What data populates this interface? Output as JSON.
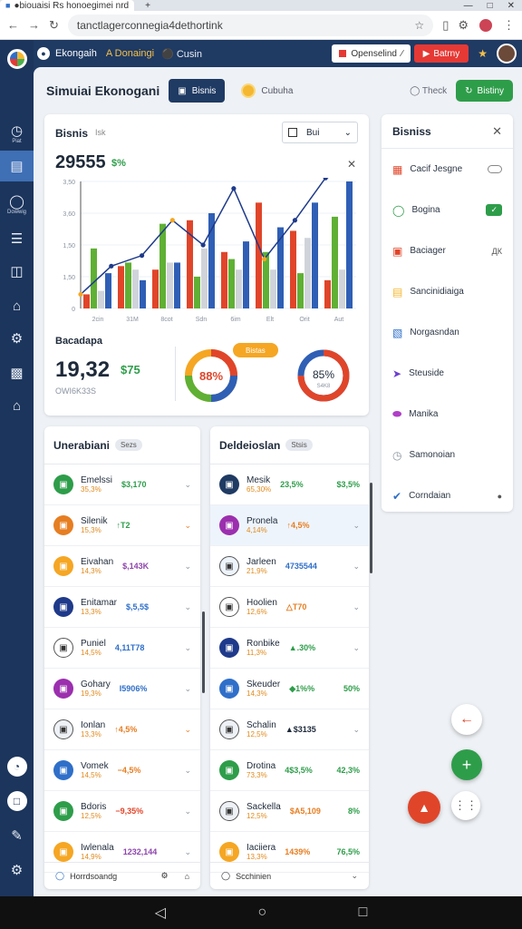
{
  "browser": {
    "tab_title": "●biouaisi Rs honoegimei nrd",
    "tab_icon": "app-icon",
    "new_tab": "+",
    "url": "tanctlagerconnegia4dethortink",
    "window": [
      "—",
      "□",
      "✕"
    ]
  },
  "appbar": {
    "brand": "Ekongaih",
    "sub1": "A Donaingi",
    "sub2": "Cusin",
    "pill1": "Openselind",
    "pill2": "Batrny"
  },
  "sim_head": {
    "title": "Simuiai Ekonogani",
    "btn_navy": "Bisnis",
    "coin_label": "Cubuha",
    "thread": "Theck",
    "btn_green": "Bistiny"
  },
  "chart_card": {
    "title": "Bisnis",
    "sub": "Isk",
    "select_label": "Bui",
    "big_value": "29555",
    "pct": "$%",
    "summary_label": "Bacadapa",
    "summary_value": "19,32",
    "summary_value2": "$75",
    "summary_sub": "OWI6K33S",
    "pill": "Bistas",
    "donut_a_label": "88%",
    "donut_b_label": "85%",
    "donut_b_sub": "S4K8",
    "donut_a_value": 0.88,
    "donut_b_value": 0.85
  },
  "chart_data": {
    "type": "bar",
    "yticks": [
      "3,50",
      "3,60",
      "1,50",
      "1,50",
      "0"
    ],
    "categories": [
      "2cin",
      "31M",
      "8cot",
      "Sdn",
      "6im",
      "Elt",
      "Orit",
      "Aut"
    ],
    "ylim": [
      0,
      3600
    ],
    "series": [
      {
        "color": "#e0452a",
        "values": [
          400,
          1200,
          1100,
          2500,
          1600,
          3000,
          2200,
          800
        ]
      },
      {
        "color": "#5fb034",
        "values": [
          1700,
          1300,
          2400,
          900,
          1400,
          1600,
          1000,
          2600
        ]
      },
      {
        "color": "#d0d4da",
        "values": [
          500,
          1100,
          1300,
          1700,
          1100,
          1100,
          2000,
          1100
        ]
      },
      {
        "color": "#2f5fb5",
        "values": [
          1000,
          800,
          1300,
          2700,
          1900,
          2300,
          3000,
          3600
        ]
      }
    ],
    "line": {
      "color": "#1e3a8a",
      "values": [
        400,
        1200,
        1500,
        2500,
        1800,
        3400,
        1400,
        2500,
        3700,
        3900
      ]
    }
  },
  "right_panel": {
    "title": "Bisniss",
    "items": [
      {
        "label": "Cacif Jesgne",
        "icon": "grid-icon",
        "color": "#e0452a",
        "right": "toggle"
      },
      {
        "label": "Bogina",
        "icon": "circle-icon",
        "color": "#2e9d4a",
        "right": "chip",
        "chip": "✓"
      },
      {
        "label": "Baciager",
        "icon": "square-icon",
        "color": "#e0452a",
        "right": "ДК"
      },
      {
        "label": "Sancinidiaiga",
        "icon": "note-icon",
        "color": "#f5b731",
        "right": ""
      },
      {
        "label": "Norgasndan",
        "icon": "box-icon",
        "color": "#2f6fc9",
        "right": ""
      },
      {
        "label": "Steuside",
        "icon": "arrow-icon",
        "color": "#6b3fd1",
        "right": ""
      },
      {
        "label": "Manika",
        "icon": "dot-icon",
        "color": "#b03fc7",
        "right": ""
      },
      {
        "label": "Samonoian",
        "icon": "clock-icon",
        "color": "#8a93a0",
        "right": ""
      },
      {
        "label": "Corndaian",
        "icon": "check-icon",
        "color": "#2f6fc9",
        "right": "●"
      }
    ]
  },
  "list_left": {
    "title": "Unerabiani",
    "tag": "Sezs",
    "rows": [
      {
        "name": "Emelssi",
        "pct": "35,3%",
        "val": "$3,170",
        "valcolor": "#2e9d4a",
        "color": "#2e9d4a"
      },
      {
        "name": "Silenik",
        "pct": "15,3%",
        "val": "↑T2",
        "valcolor": "#2e9d4a",
        "color": "#e67e22"
      },
      {
        "name": "Eivahan",
        "pct": "14,3%",
        "val": "$,143K",
        "valcolor": "#8e44ad",
        "color": "#f5a623"
      },
      {
        "name": "Enitamar",
        "pct": "13,3%",
        "val": "$,5,5$",
        "valcolor": "#2f6fc9",
        "color": "#1f3a8a"
      },
      {
        "name": "Puniel",
        "pct": "14,5%",
        "val": "4,11T78",
        "valcolor": "#2f6fc9",
        "color": "#ffffff"
      },
      {
        "name": "Gohary",
        "pct": "19,3%",
        "val": "I5906%",
        "valcolor": "#2f6fc9",
        "color": "#9b2fae"
      },
      {
        "name": "Ionlan",
        "pct": "13,3%",
        "val": "↑4,5%",
        "valcolor": "#e67e22",
        "color": "#eef1f5"
      },
      {
        "name": "Vomek",
        "pct": "14,5%",
        "val": "−4,5%",
        "valcolor": "#e67e22",
        "color": "#2f6fc9"
      },
      {
        "name": "Bdoris",
        "pct": "12,5%",
        "val": "−9,35%",
        "valcolor": "#e0452a",
        "color": "#2e9d4a"
      },
      {
        "name": "Iwlenala",
        "pct": "14,9%",
        "val": "1232,144",
        "valcolor": "#8e44ad",
        "color": "#f5a623"
      }
    ],
    "footer": "Horrdsoandg",
    "footer_end": "⌂"
  },
  "list_right": {
    "title": "Deldeioslan",
    "tag": "Stsis",
    "rows": [
      {
        "name": "Mesik",
        "pct": "65,30%",
        "val": "23,5%",
        "valcolor": "#2e9d4a",
        "val2": "$3,5%",
        "val2color": "#2e9d4a",
        "color": "#1f3a63"
      },
      {
        "name": "Pronela",
        "pct": "4,14%",
        "val": "↑4,5%",
        "valcolor": "#e67e22",
        "val2": "",
        "val2color": "#2e9d4a",
        "color": "#9b2fae",
        "hl": true
      },
      {
        "name": "Jarleen",
        "pct": "21,9%",
        "val": "4735544",
        "valcolor": "#2f6fc9",
        "val2": "",
        "val2color": "#2e9d4a",
        "color": "#eef4fb"
      },
      {
        "name": "Hoolien",
        "pct": "12,6%",
        "val": "△T70",
        "valcolor": "#e67e22",
        "val2": "",
        "val2color": "#2e9d4a",
        "color": "#ffffff"
      },
      {
        "name": "Ronbike",
        "pct": "11,3%",
        "val": "▲.30%",
        "valcolor": "#2e9d4a",
        "val2": "",
        "val2color": "#2e9d4a",
        "color": "#1f3a8a"
      },
      {
        "name": "Skeuder",
        "pct": "14,3%",
        "val": "◆1%%",
        "valcolor": "#2e9d4a",
        "val2": "50%",
        "val2color": "#2e9d4a",
        "color": "#2f6fc9"
      },
      {
        "name": "Schalin",
        "pct": "12,5%",
        "val": "▲$3135",
        "valcolor": "#1e2a3a",
        "val2": "",
        "val2color": "#2e9d4a",
        "color": "#eef1f5"
      },
      {
        "name": "Drotina",
        "pct": "73,3%",
        "val": "4$3,5%",
        "valcolor": "#2e9d4a",
        "val2": "42,3%",
        "val2color": "#2e9d4a",
        "color": "#2e9d4a"
      },
      {
        "name": "Sackella",
        "pct": "12,5%",
        "val": "$A5,109",
        "valcolor": "#e67e22",
        "val2": "8%",
        "val2color": "#2e9d4a",
        "color": "#eef1f5"
      },
      {
        "name": "Iaciiera",
        "pct": "13,3%",
        "val": "1439%",
        "valcolor": "#e67e22",
        "val2": "76,5%",
        "val2color": "#2e9d4a",
        "color": "#f5a623"
      }
    ],
    "footer": "Scchinien",
    "footer_end": "⌄"
  },
  "rail": [
    {
      "icon": "palette-icon",
      "label": "",
      "active": false
    },
    {
      "icon": "dashboard-icon",
      "label": "Piat",
      "active": false
    },
    {
      "icon": "document-icon",
      "label": "",
      "active": true
    },
    {
      "icon": "globe-icon",
      "label": "Dowwig",
      "active": false
    },
    {
      "icon": "list-icon",
      "label": "",
      "active": false
    },
    {
      "icon": "book-icon",
      "label": "",
      "active": false
    },
    {
      "icon": "home-icon",
      "label": "",
      "active": false
    },
    {
      "icon": "settings-icon",
      "label": "",
      "active": false
    },
    {
      "icon": "chart-icon",
      "label": "",
      "active": false
    },
    {
      "icon": "bank-icon",
      "label": "",
      "active": false
    }
  ]
}
